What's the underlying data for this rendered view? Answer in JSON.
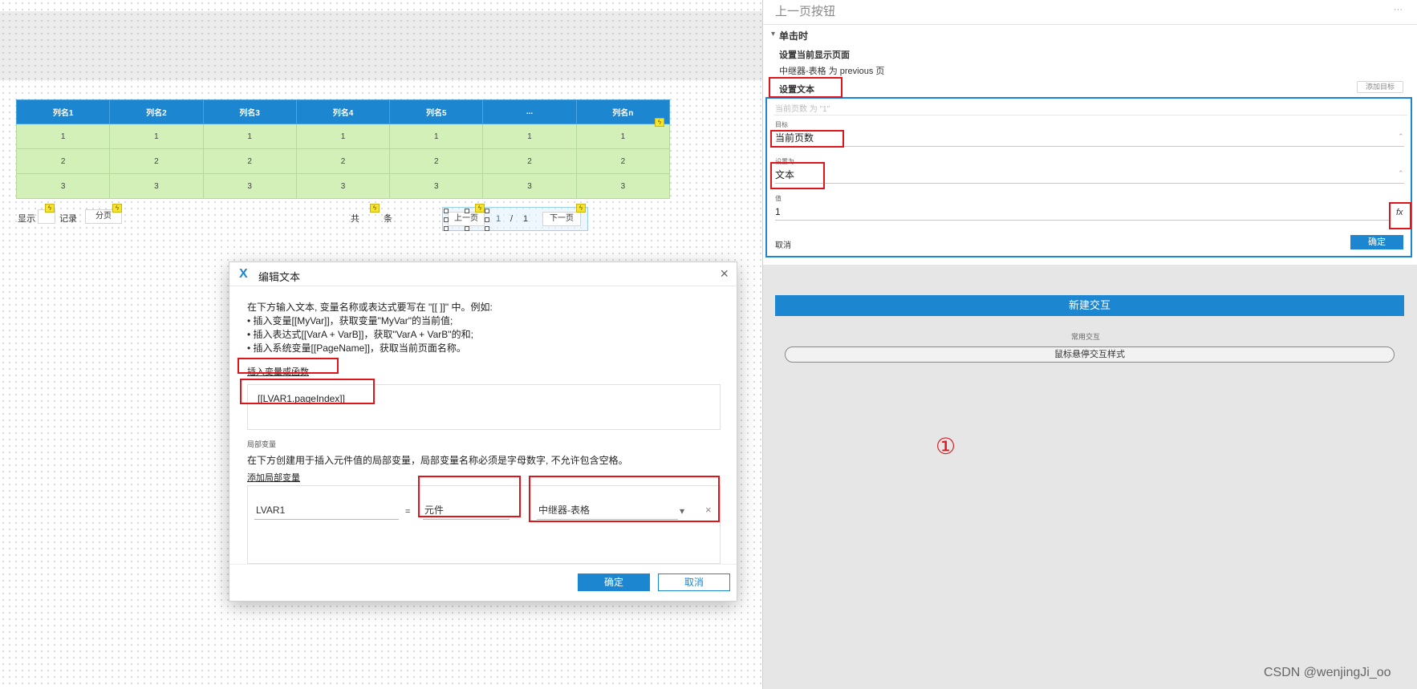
{
  "canvas": {
    "table": {
      "headers": [
        "列名1",
        "列名2",
        "列名3",
        "列名4",
        "列名5",
        "...",
        "列名n"
      ],
      "rows": [
        [
          "1",
          "1",
          "1",
          "1",
          "1",
          "1",
          "1"
        ],
        [
          "2",
          "2",
          "2",
          "2",
          "2",
          "2",
          "2"
        ],
        [
          "3",
          "3",
          "3",
          "3",
          "3",
          "3",
          "3"
        ]
      ]
    },
    "pager": {
      "show_label": "显示",
      "records_label": "记录",
      "paging_label": "分页",
      "total_label": "共",
      "items_label": "条",
      "prev_label": "上一页",
      "current_page": "1",
      "separator": "/",
      "total_pages": "1",
      "next_label": "下一页"
    }
  },
  "dialog": {
    "logo": "X",
    "title": "编辑文本",
    "close": "×",
    "desc_lines": [
      "在下方输入文本, 变量名称或表达式要写在 \"[[ ]]\" 中。例如:",
      "• 插入变量[[MyVar]]，获取变量\"MyVar\"的当前值;",
      "• 插入表达式[[VarA + VarB]]，获取\"VarA + VarB\"的和;",
      "• 插入系统变量[[PageName]]，获取当前页面名称。"
    ],
    "insert_link": "插入变量或函数",
    "expression": "[[LVAR1.pageIndex]]",
    "local_title": "局部变量",
    "local_desc": "在下方创建用于插入元件值的局部变量，局部变量名称必须是字母数字, 不允许包含空格。",
    "add_local": "添加局部变量",
    "var_name": "LVAR1",
    "equals": "=",
    "var_type": "元件",
    "var_target": "中继器-表格",
    "dropdown_icon": "▾",
    "remove_icon": "×",
    "ok_label": "确定",
    "cancel_label": "取消"
  },
  "panel": {
    "header_partial": "上一页按钮",
    "more_icon": "···",
    "event_label": "单击时",
    "action1_title": "设置当前显示页面",
    "action1_detail": "中继器-表格 为 previous 页",
    "action2_title": "设置文本",
    "add_target": "添加目标",
    "summary": "当前页数 为 \"1\"",
    "target_label": "目标",
    "target_value": "当前页数",
    "setto_label": "设置为",
    "setto_value": "文本",
    "value_label": "值",
    "value_value": "1",
    "fx_icon": "fx",
    "cancel_label": "取消",
    "ok_label": "确定",
    "new_interaction": "新建交互",
    "common_label": "常用交互",
    "hover_style": "鼠标悬停交互样式",
    "marker": "①"
  },
  "watermark": "CSDN @wenjingJi_oo"
}
